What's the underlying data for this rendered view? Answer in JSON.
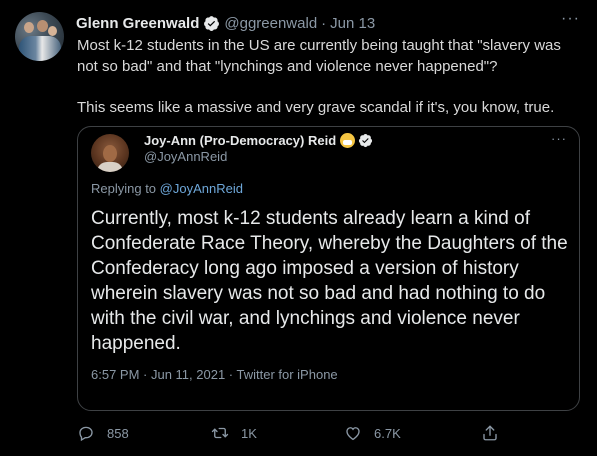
{
  "tweet": {
    "author_name": "Glenn Greenwald",
    "handle": "@ggreenwald",
    "separator": "·",
    "date": "Jun 13",
    "more": "···",
    "text_line1": "Most k-12 students in the US are currently being taught that \"slavery was not so bad\" and that \"lynchings and violence never happened\"?",
    "text_line2": "This seems like a massive and very grave scandal if it's, you know, true."
  },
  "quote": {
    "author_name": "Joy-Ann (Pro-Democracy) Reid",
    "handle": "@JoyAnnReid",
    "more": "···",
    "replying_prefix": "Replying to ",
    "replying_mention": "@JoyAnnReid",
    "text": "Currently, most k-12 students already learn a kind of Confederate Race Theory, whereby the Daughters of the Confederacy long ago imposed a version of history wherein slavery was not so bad and had nothing to do with the civil war, and lynchings and violence never happened.",
    "timestamp": "6:57 PM · Jun 11, 2021 · Twitter for iPhone"
  },
  "actions": {
    "replies": "858",
    "retweets": "1K",
    "likes": "6.7K"
  },
  "colors": {
    "background": "#000000",
    "muted": "#8b98a5",
    "mention": "#6ea7d9",
    "border": "#3e4144"
  },
  "icons": [
    "verified-badge-icon",
    "more-icon",
    "reply-icon",
    "retweet-icon",
    "like-icon",
    "share-icon",
    "grimacing-emoji-icon"
  ]
}
